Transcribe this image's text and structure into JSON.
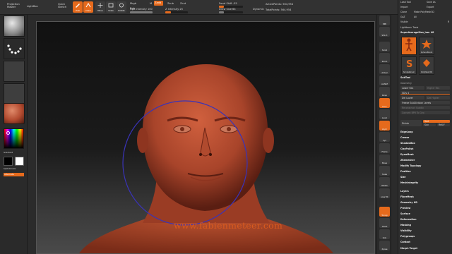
{
  "topbar": {
    "projection_master": "Projection Master",
    "lightbox": "LightBox",
    "quick_sketch": "Quick Sketch",
    "edit": "Edit",
    "draw": "Draw",
    "move": "Move",
    "scale": "Scale",
    "rotate": "Rotate",
    "mrgb": "Mrgb",
    "rgb": "Rgb",
    "m": "M",
    "zadd": "Zadd",
    "zsub": "Zsub",
    "zcut": "Zcut",
    "rgb_intensity": "Rgb Intensity 100",
    "z_intensity": "Z Intensity 25",
    "focal_shift": "Focal Shift -55",
    "draw_size": "Draw Size 64",
    "dynamic": "Dynamic",
    "active_points": "ActivePoints: 564,954",
    "total_points": "TotalPoints: 564,954"
  },
  "left_shelf": {
    "gradient_label": "Gradient",
    "switch_color_label": "SwitchColor",
    "alternate_label": "Alternate"
  },
  "right_shelf": {
    "buttons": [
      "BPR",
      "SPix 3",
      "Scroll",
      "Zoom",
      "Actual",
      "AAHalf",
      "Persp",
      "Floor",
      "Local",
      "LSym",
      "Xyz",
      "Frame",
      "Move",
      "Scale",
      "Rotate",
      "Line Fill",
      "Transp",
      "Ghost",
      "Solo",
      "Xpose"
    ]
  },
  "tray": {
    "load_tool": "Load Tool",
    "save_as": "Save As",
    "import": "Import",
    "export": "Export",
    "clone": "Clone",
    "make_polymesh": "Make PolyMesh3D",
    "goz": "GoZ",
    "all": "All",
    "visible": "Visible",
    "r": "R",
    "lightbox_tools": "Lightbox> Tools",
    "current_tool": "SuperAverageMan_low. 48",
    "tools": [
      "SuperAverageMan_low",
      "SphereBrush",
      "SimpleBrush",
      "PolyMesh3D"
    ],
    "subtool": "SubTool",
    "geometry": "Geometry",
    "lower_res": "Lower Res",
    "higher_res": "Higher Res",
    "sdiv": "SDiv 4",
    "del_lower": "Del Lower",
    "del_higher": "Del Higher",
    "freeze_subdivision": "Freeze SubDivision Levels",
    "reconstruct_subdiv": "Reconstruct Subdiv",
    "convert_bpr": "Convert BPR To Geo",
    "divide": "Divide",
    "smt": "Smt",
    "suv": "Suv",
    "reuv": "ReUV",
    "sections": [
      "EdgeLoop",
      "Crease",
      "ShadowBox",
      "ClayPolish",
      "DynaMesh",
      "ZRemesher",
      "Modify Topology",
      "Position",
      "Size",
      "MeshIntegrity"
    ],
    "sections2": [
      "Layers",
      "FiberMesh",
      "Geometry HD",
      "Preview",
      "Surface",
      "Deformation",
      "Masking",
      "Visibility",
      "Polygroups",
      "Contact",
      "Morph Target"
    ]
  },
  "watermark": "www.fabienmeteer.com",
  "colors": {
    "accent": "#e66a1c",
    "skin": "#b24a2f",
    "brush_circle": "#3a33b8"
  }
}
